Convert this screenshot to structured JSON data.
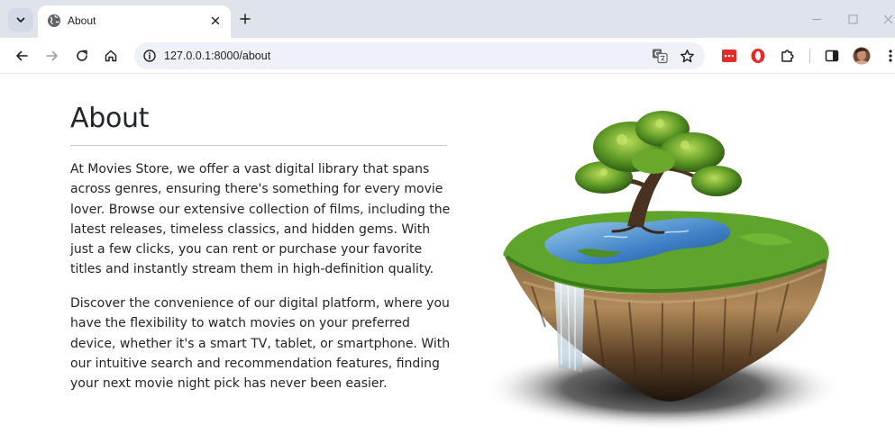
{
  "browser": {
    "tab": {
      "title": "About"
    },
    "address": {
      "url": "127.0.0.1:8000/about"
    },
    "icons": [
      "tab-search-icon",
      "globe-icon",
      "close-icon",
      "plus-icon",
      "minimize-icon",
      "maximize-icon",
      "window-close-icon",
      "back-arrow-icon",
      "forward-arrow-icon",
      "reload-icon",
      "home-icon",
      "info-icon",
      "translate-icon",
      "star-icon",
      "extension-red-icon",
      "opera-icon",
      "puzzle-icon",
      "side-panel-icon",
      "avatar",
      "kebab-menu-icon"
    ]
  },
  "page": {
    "title": "About",
    "paragraphs": [
      "At Movies Store, we offer a vast digital library that spans across genres, ensuring there's something for every movie lover. Browse our extensive collection of films, including the latest releases, timeless classics, and hidden gems. With just a few clicks, you can rent or purchase your favorite titles and instantly stream them in high-definition quality.",
      "Discover the convenience of our digital platform, where you have the flexibility to watch movies on your preferred device, whether it's a smart TV, tablet, or smartphone. With our intuitive search and recommendation features, finding your next movie night pick has never been easier."
    ]
  },
  "colors": {
    "tabstrip": "#dfe3ea",
    "omnibox": "#eef1f8",
    "text": "#212529",
    "accent_red": "#e52a2a",
    "grass": "#5fa42c",
    "water": "#3d7fc6"
  }
}
